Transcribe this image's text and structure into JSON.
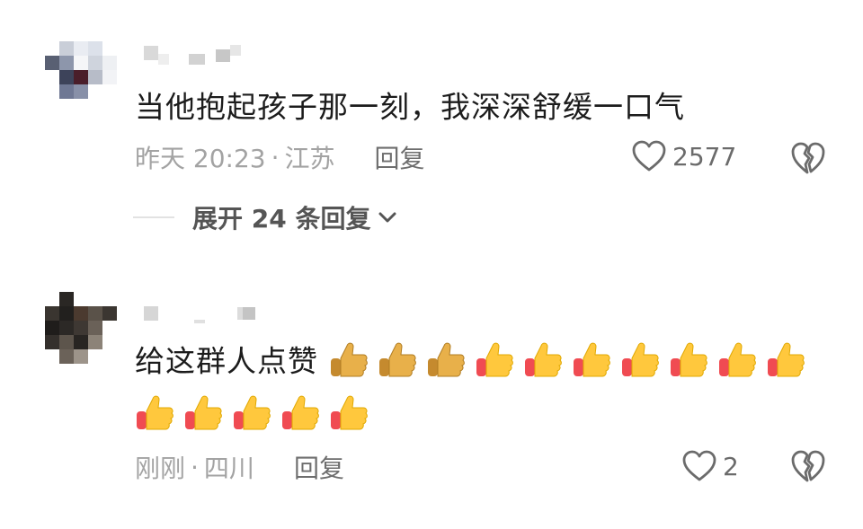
{
  "comments": [
    {
      "text": "当他抱起孩子那一刻，我深深舒缓一口气",
      "time": "昨天 20:23",
      "separator": "·",
      "location": "江苏",
      "reply_label": "回复",
      "likes": "2577",
      "thumbs_count": 0
    },
    {
      "text": "给这群人点赞",
      "time": "刚刚",
      "separator": "·",
      "location": "四川",
      "reply_label": "回复",
      "likes": "2",
      "thumbs_count": 15
    }
  ],
  "expand_replies": {
    "label": "展开 24 条回复",
    "icon": "chevron-down-icon"
  },
  "icons": {
    "like": "heart-outline-icon",
    "dislike": "broken-heart-icon",
    "thumb": "thumbs-up-emoji"
  },
  "colors": {
    "meta_text": "#a3a3a3",
    "reply_text": "#6e6e6e",
    "body_text": "#1c1c1c",
    "thumb_yellow": "#ffc83d",
    "thumb_red": "#f04b52"
  }
}
